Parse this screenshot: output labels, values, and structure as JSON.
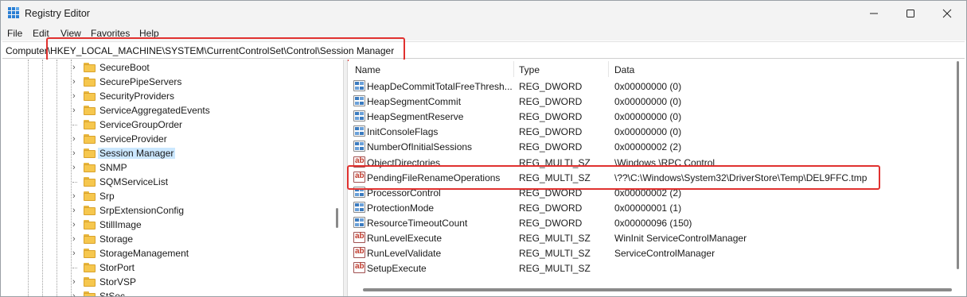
{
  "window": {
    "title": "Registry Editor",
    "minimize_icon": "minimize-icon",
    "maximize_icon": "maximize-icon",
    "close_icon": "close-icon"
  },
  "menu": [
    "File",
    "Edit",
    "View",
    "Favorites",
    "Help"
  ],
  "address": {
    "path": "Computer\\HKEY_LOCAL_MACHINE\\SYSTEM\\CurrentControlSet\\Control\\Session Manager"
  },
  "tree": {
    "items": [
      {
        "label": "SecureBoot",
        "expandable": true
      },
      {
        "label": "SecurePipeServers",
        "expandable": true
      },
      {
        "label": "SecurityProviders",
        "expandable": true
      },
      {
        "label": "ServiceAggregatedEvents",
        "expandable": true
      },
      {
        "label": "ServiceGroupOrder",
        "expandable": false
      },
      {
        "label": "ServiceProvider",
        "expandable": true
      },
      {
        "label": "Session Manager",
        "expandable": true,
        "selected": true
      },
      {
        "label": "SNMP",
        "expandable": true
      },
      {
        "label": "SQMServiceList",
        "expandable": false
      },
      {
        "label": "Srp",
        "expandable": true
      },
      {
        "label": "SrpExtensionConfig",
        "expandable": true
      },
      {
        "label": "StillImage",
        "expandable": true
      },
      {
        "label": "Storage",
        "expandable": true
      },
      {
        "label": "StorageManagement",
        "expandable": true
      },
      {
        "label": "StorPort",
        "expandable": false
      },
      {
        "label": "StorVSP",
        "expandable": true
      },
      {
        "label": "StSec",
        "expandable": true
      }
    ]
  },
  "list": {
    "columns": [
      "Name",
      "Type",
      "Data"
    ],
    "rows": [
      {
        "name": "HeapDeCommitTotalFreeThresh...",
        "type": "REG_DWORD",
        "data": "0x00000000 (0)",
        "icon": "binary-value-icon"
      },
      {
        "name": "HeapSegmentCommit",
        "type": "REG_DWORD",
        "data": "0x00000000 (0)",
        "icon": "binary-value-icon"
      },
      {
        "name": "HeapSegmentReserve",
        "type": "REG_DWORD",
        "data": "0x00000000 (0)",
        "icon": "binary-value-icon"
      },
      {
        "name": "InitConsoleFlags",
        "type": "REG_DWORD",
        "data": "0x00000000 (0)",
        "icon": "binary-value-icon"
      },
      {
        "name": "NumberOfInitialSessions",
        "type": "REG_DWORD",
        "data": "0x00000002 (2)",
        "icon": "binary-value-icon"
      },
      {
        "name": "ObjectDirectories",
        "type": "REG_MULTI_SZ",
        "data": "\\Windows \\RPC Control",
        "icon": "string-value-icon"
      },
      {
        "name": "PendingFileRenameOperations",
        "type": "REG_MULTI_SZ",
        "data": "\\??\\C:\\Windows\\System32\\DriverStore\\Temp\\DEL9FFC.tmp",
        "icon": "string-value-icon"
      },
      {
        "name": "ProcessorControl",
        "type": "REG_DWORD",
        "data": "0x00000002 (2)",
        "icon": "binary-value-icon"
      },
      {
        "name": "ProtectionMode",
        "type": "REG_DWORD",
        "data": "0x00000001 (1)",
        "icon": "binary-value-icon"
      },
      {
        "name": "ResourceTimeoutCount",
        "type": "REG_DWORD",
        "data": "0x00000096 (150)",
        "icon": "binary-value-icon"
      },
      {
        "name": "RunLevelExecute",
        "type": "REG_MULTI_SZ",
        "data": "WinInit ServiceControlManager",
        "icon": "string-value-icon"
      },
      {
        "name": "RunLevelValidate",
        "type": "REG_MULTI_SZ",
        "data": "ServiceControlManager",
        "icon": "string-value-icon"
      },
      {
        "name": "SetupExecute",
        "type": "REG_MULTI_SZ",
        "data": "",
        "icon": "string-value-icon"
      }
    ]
  },
  "colors": {
    "highlight_box": "#e0312f",
    "selection": "#cce8ff",
    "folder": "#f6c74e"
  }
}
